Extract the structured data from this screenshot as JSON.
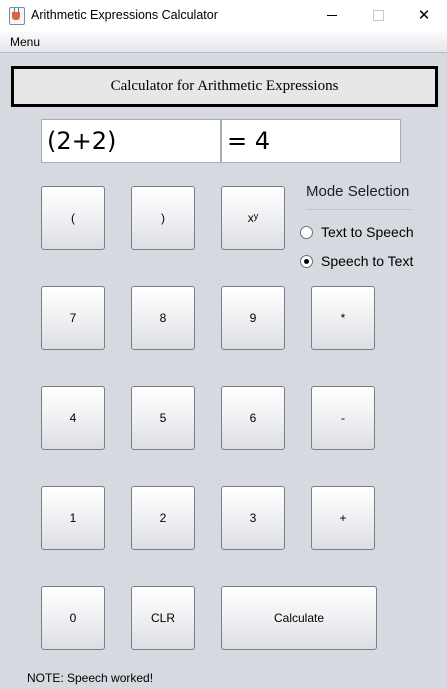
{
  "window": {
    "title": "Arithmetic Expressions Calculator",
    "close_glyph": "✕"
  },
  "menubar": {
    "menu_label": "Menu"
  },
  "header": {
    "title": "Calculator for Arithmetic Expressions"
  },
  "display": {
    "expression": "(2+2)",
    "result": "= 4"
  },
  "keys": {
    "open_paren": "(",
    "close_paren": ")",
    "power_base": "x",
    "power_exp": "y",
    "seven": "7",
    "eight": "8",
    "nine": "9",
    "multiply": "*",
    "four": "4",
    "five": "5",
    "six": "6",
    "minus": "-",
    "one": "1",
    "two": "2",
    "three": "3",
    "plus": "+",
    "zero": "0",
    "clear": "CLR",
    "calculate": "Calculate"
  },
  "mode": {
    "title": "Mode Selection",
    "options": [
      {
        "label": "Text to Speech",
        "selected": false
      },
      {
        "label": "Speech to Text",
        "selected": true
      }
    ]
  },
  "status": {
    "note": "NOTE: Speech worked!"
  }
}
